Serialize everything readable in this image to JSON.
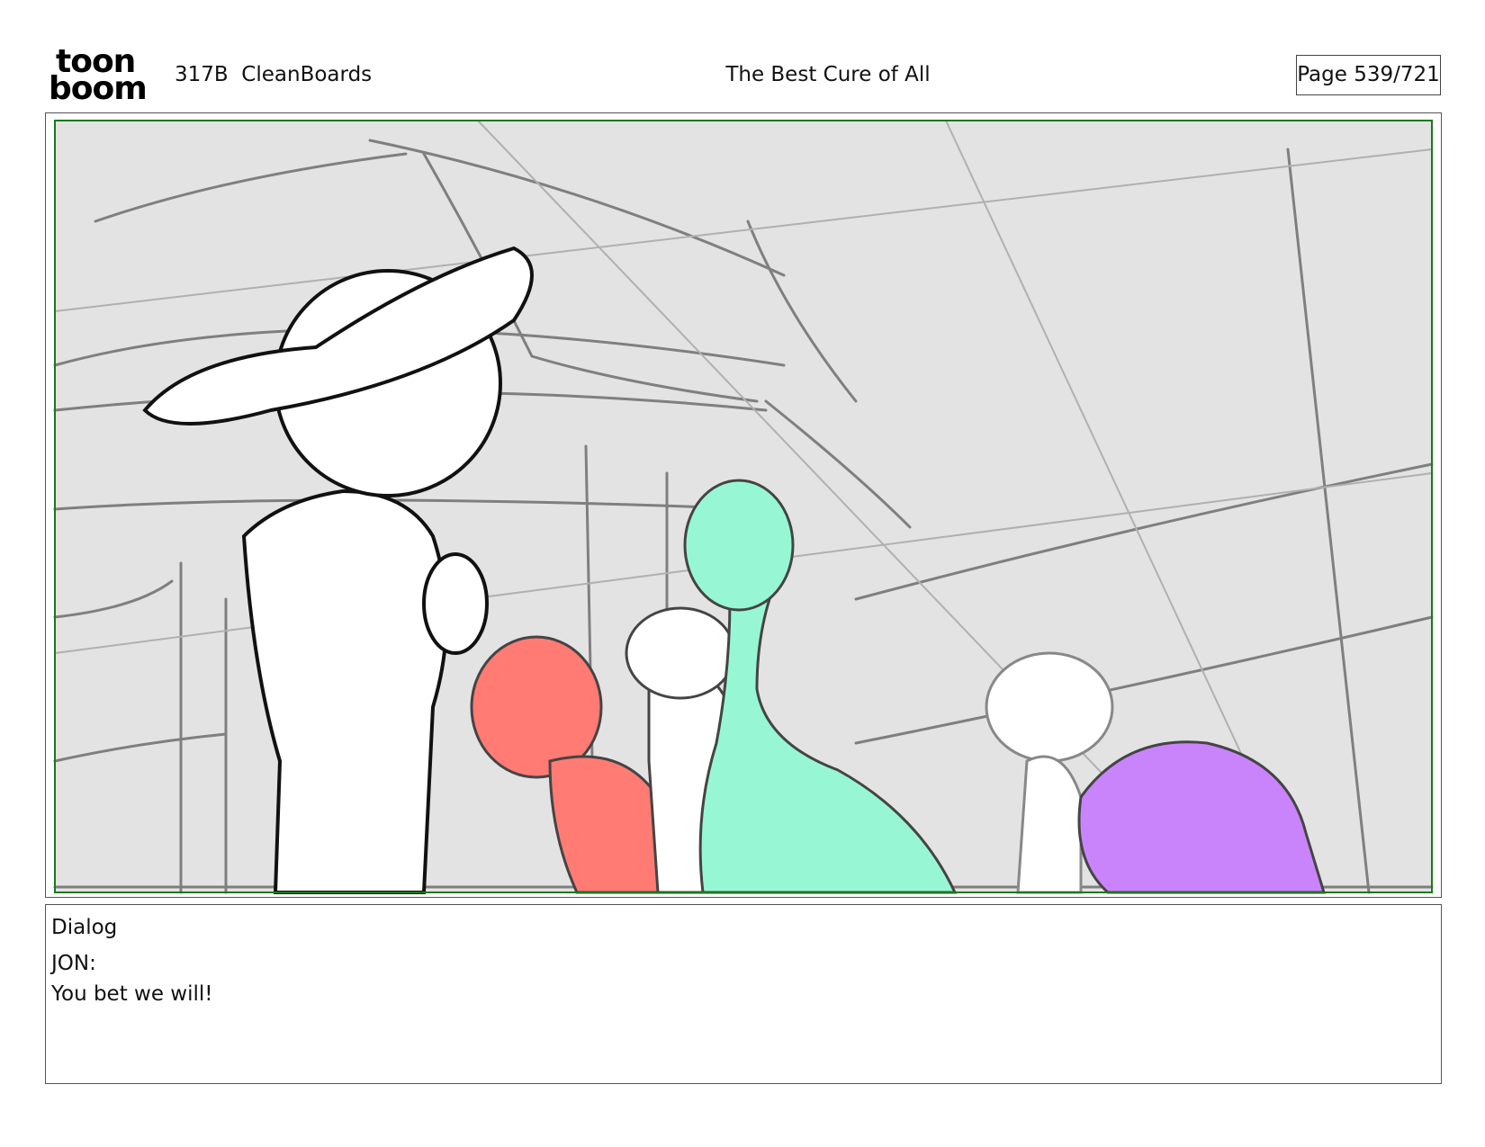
{
  "header": {
    "logo_top": "toon",
    "logo_bottom": "boom",
    "episode": "317B  CleanBoards",
    "title": "The Best Cure of All",
    "page": "Page 539/721"
  },
  "panel": {
    "frame_color": "#1a7a1a",
    "background_color": "#e3e3e3",
    "character_colors": [
      "#ff7b74",
      "#97f7d4",
      "#c984fb"
    ]
  },
  "dialog": {
    "heading": "Dialog",
    "speaker": "JON:",
    "line": "You bet we will!"
  }
}
